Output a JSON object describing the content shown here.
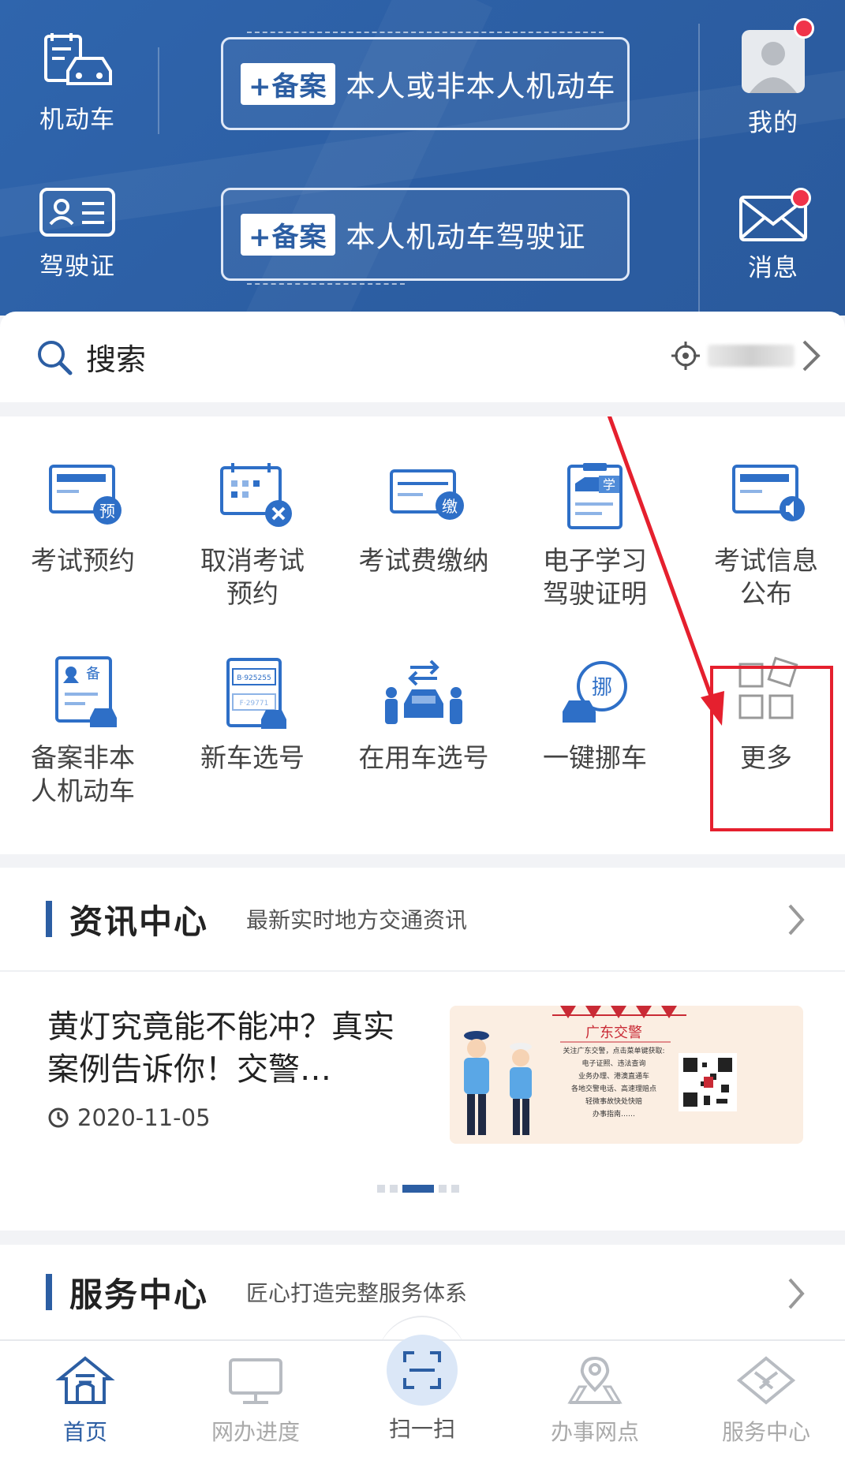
{
  "header": {
    "vehicle_label": "机动车",
    "license_label": "驾驶证",
    "record_badge": "+备案",
    "record1_text": "本人或非本人机动车",
    "record2_text": "本人机动车驾驶证",
    "mine_label": "我的",
    "message_label": "消息"
  },
  "search": {
    "label": "搜索"
  },
  "services": [
    {
      "line1": "考试预约",
      "line2": "",
      "icon": "exam-booking-icon",
      "icon_badge": "预"
    },
    {
      "line1": "取消考试",
      "line2": "预约",
      "icon": "cancel-exam-icon",
      "icon_badge": ""
    },
    {
      "line1": "考试费缴纳",
      "line2": "",
      "icon": "exam-fee-icon",
      "icon_badge": "缴"
    },
    {
      "line1": "电子学习",
      "line2": "驾驶证明",
      "icon": "e-learning-icon",
      "icon_badge": "学"
    },
    {
      "line1": "考试信息",
      "line2": "公布",
      "icon": "exam-info-icon",
      "icon_badge": ""
    },
    {
      "line1": "备案非本",
      "line2": "人机动车",
      "icon": "record-vehicle-icon",
      "icon_badge": "备"
    },
    {
      "line1": "新车选号",
      "line2": "",
      "icon": "new-plate-icon",
      "icon_badge": "",
      "plate_top": "B·925255",
      "plate_bottom": "F·29771"
    },
    {
      "line1": "在用车选号",
      "line2": "",
      "icon": "used-plate-icon",
      "icon_badge": ""
    },
    {
      "line1": "一键挪车",
      "line2": "",
      "icon": "move-car-icon",
      "icon_badge": "挪"
    },
    {
      "line1": "更多",
      "line2": "",
      "icon": "more-grid-icon",
      "icon_badge": ""
    }
  ],
  "news_section": {
    "title": "资讯中心",
    "subtitle": "最新实时地方交通资讯",
    "article_title": "黄灯究竟能不能冲？真实案例告诉你！交警…",
    "article_date": "2020-11-05",
    "image_heading": "广东交警",
    "image_lines": [
      "关注广东交警，点击菜单键获取:",
      "电子证照、违法查询",
      "业务办理、港澳直通车",
      "各地交警电话、高速理赔点",
      "轻微事故快处快赔",
      "办事指南……"
    ],
    "carousel_count": 5,
    "carousel_active": 2
  },
  "service_section": {
    "title": "服务中心",
    "subtitle": "匠心打造完整服务体系"
  },
  "nav": {
    "home": "首页",
    "progress": "网办进度",
    "scan": "扫一扫",
    "outlets": "办事网点",
    "service": "服务中心"
  },
  "colors": {
    "brand_blue": "#2c5ea3",
    "alert_red": "#e5202e"
  }
}
